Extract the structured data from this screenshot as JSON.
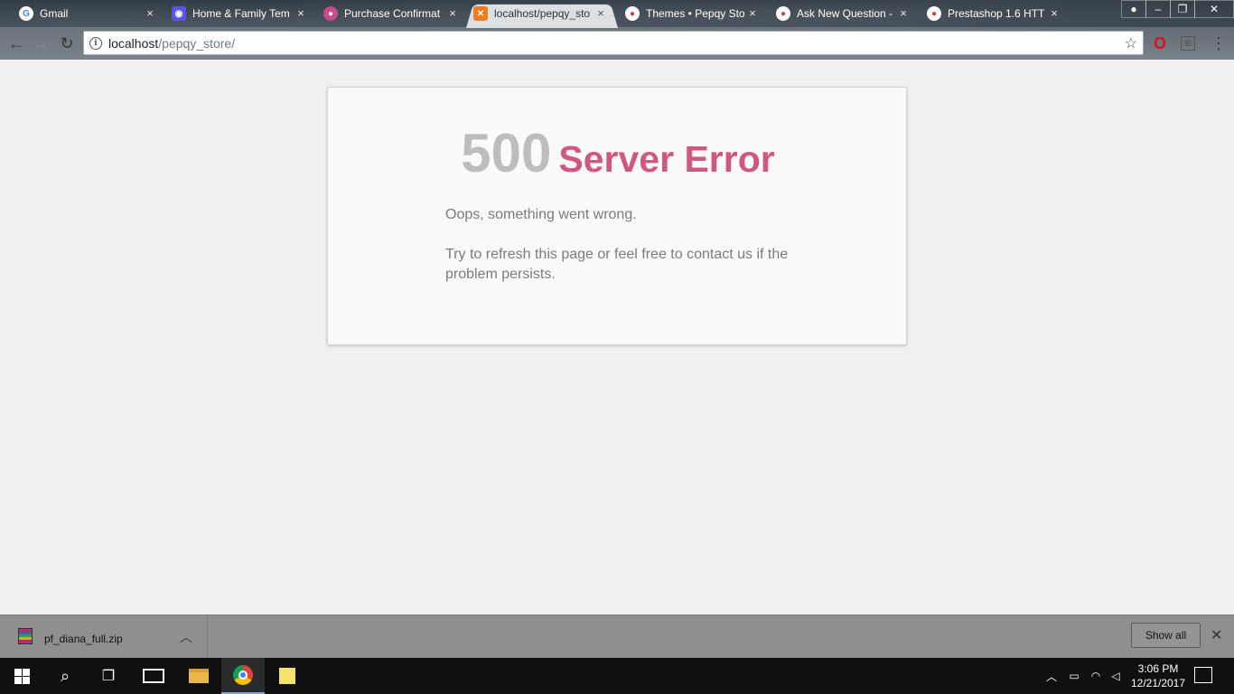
{
  "browser": {
    "tabs": [
      {
        "title": "Gmail",
        "favicon": "google-icon",
        "favicon_color": "#ffffff",
        "active": false
      },
      {
        "title": "Home & Family Tem",
        "favicon": "templatemonster-icon",
        "favicon_color": "#5a55e6",
        "active": false
      },
      {
        "title": "Purchase Confirmat",
        "favicon": "envato-icon",
        "favicon_color": "#c94b8a",
        "active": false
      },
      {
        "title": "localhost/pepqy_sto",
        "favicon": "xampp-icon",
        "favicon_color": "#f07c22",
        "active": true
      },
      {
        "title": "Themes • Pepqy Sto",
        "favicon": "prestashop-icon",
        "favicon_color": "#d23c5a",
        "active": false
      },
      {
        "title": "Ask New Question -",
        "favicon": "prestashop-icon",
        "favicon_color": "#d23c5a",
        "active": false
      },
      {
        "title": "Prestashop 1.6 HTT",
        "favicon": "prestashop-icon",
        "favicon_color": "#d23c5a",
        "active": false
      }
    ],
    "tab_close_glyph": "×",
    "address": {
      "host": "localhost",
      "path": "/pepqy_store/"
    }
  },
  "page": {
    "error_code": "500",
    "error_label": "Server Error",
    "message_1": "Oops, something went wrong.",
    "message_2": "Try to refresh this page or feel free to contact us if the problem persists.",
    "colors": {
      "code": "#bdbdbd",
      "label": "#d05781",
      "text": "#7a7a7a"
    }
  },
  "downloads": {
    "file_name": "pf_diana_full.zip",
    "show_all_label": "Show all"
  },
  "taskbar": {
    "time": "3:06 PM",
    "date": "12/21/2017"
  }
}
